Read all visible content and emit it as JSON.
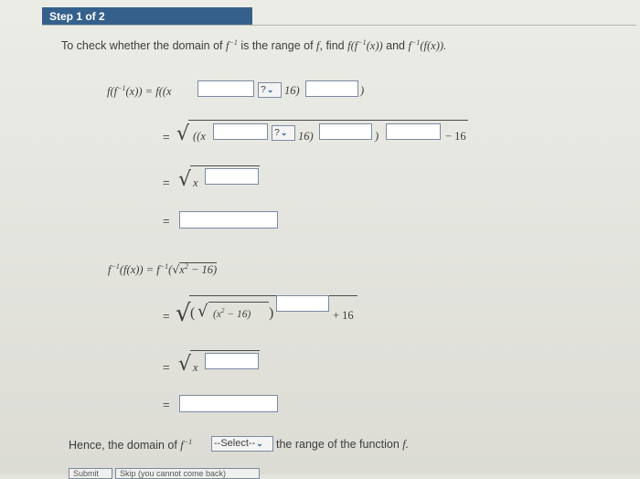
{
  "step": {
    "label": "Step 1 of 2"
  },
  "intro": {
    "text_a": "To check whether the domain of ",
    "f_inv": "f",
    "sup_neg1": "−1",
    "text_b": " is the range of ",
    "f": "f",
    "text_c": ", find ",
    "expr1": "f(f",
    "expr1_end": "(x))",
    "and": " and ",
    "expr2": "f",
    "expr2_end": "(f(x))."
  },
  "row1": {
    "lhs": "f(f",
    "lhs_end": "(x)) = f((x",
    "sel": "?",
    "after_sel": "16)",
    "close": ")"
  },
  "row2": {
    "eq": "=",
    "inner": "((x",
    "sel": "?",
    "after_sel": "16)",
    "close": ")",
    "tail": "− 16"
  },
  "row3": {
    "eq": "=",
    "x": "x"
  },
  "row4": {
    "eq": "="
  },
  "row5": {
    "lhs": "f",
    "lhs_mid": "(f(x)) = f",
    "open": "(",
    "arg": "x",
    "sup2": "2",
    "tail": " − 16)"
  },
  "row6": {
    "eq": "=",
    "inner": "(x",
    "sup2": "2",
    "inner_end": " − 16)",
    "tail": "+ 16"
  },
  "row7": {
    "eq": "=",
    "x": "x"
  },
  "row8": {
    "eq": "="
  },
  "conclusion": {
    "text_a": "Hence, the domain of ",
    "f": "f",
    "select": "--Select--",
    "text_b": " the range of the function ",
    "f2": "f."
  },
  "buttons": {
    "submit": "Submit",
    "skip": "Skip (you cannot come back)"
  }
}
